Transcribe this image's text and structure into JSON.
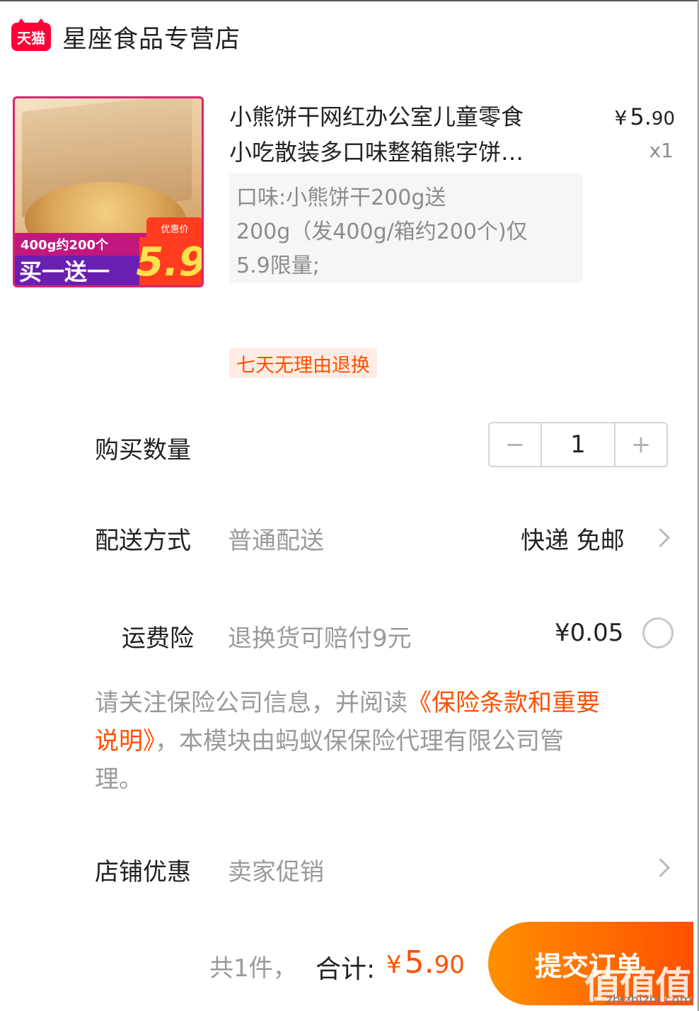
{
  "store": {
    "badge": "天猫",
    "name": "星座食品专营店"
  },
  "product": {
    "image_text": {
      "weight": "400g约200个",
      "promo": "买一送一",
      "price_tag": "优惠价",
      "price": "5.9"
    },
    "title_line1": "小熊饼干网红办公室儿童零食",
    "title_line2": "小吃散装多口味整箱熊字饼…",
    "price_yen": "¥",
    "price_int": "5.",
    "price_cents": "90",
    "quantity": "x1",
    "spec_line1": "口味:小熊饼干200g送",
    "spec_line2": "200g（发400g/箱约200个)仅",
    "spec_line3": "5.9限量;",
    "return_tag": "七天无理由退换"
  },
  "purchase_qty": {
    "label": "购买数量",
    "minus": "−",
    "value": "1",
    "plus": "+"
  },
  "delivery": {
    "label": "配送方式",
    "method": "普通配送",
    "value": "快递 免邮"
  },
  "insurance": {
    "label": "运费险",
    "desc": "退换货可赔付9元",
    "price": "¥0.05",
    "note_line1_a": "请关注保险公司信息，并阅读",
    "note_line1_b": "《保险条款和重要",
    "note_line2_a": "说明》",
    "note_line2_b": "，本模块由蚂蚁保保险代理有限公司管",
    "note_line3": "理。"
  },
  "discount": {
    "label": "店铺优惠",
    "value": "卖家促销"
  },
  "footer": {
    "count": "共1件，",
    "total_label": "合计:",
    "total_yen": "¥",
    "total_int": "5.",
    "total_cents": "90",
    "submit": "提交订单",
    "watermark": "值值值",
    "watermark_url": "zhizhizhi.com"
  },
  "colors": {
    "accent": "#ff5000",
    "tmall": "#ff0036"
  }
}
